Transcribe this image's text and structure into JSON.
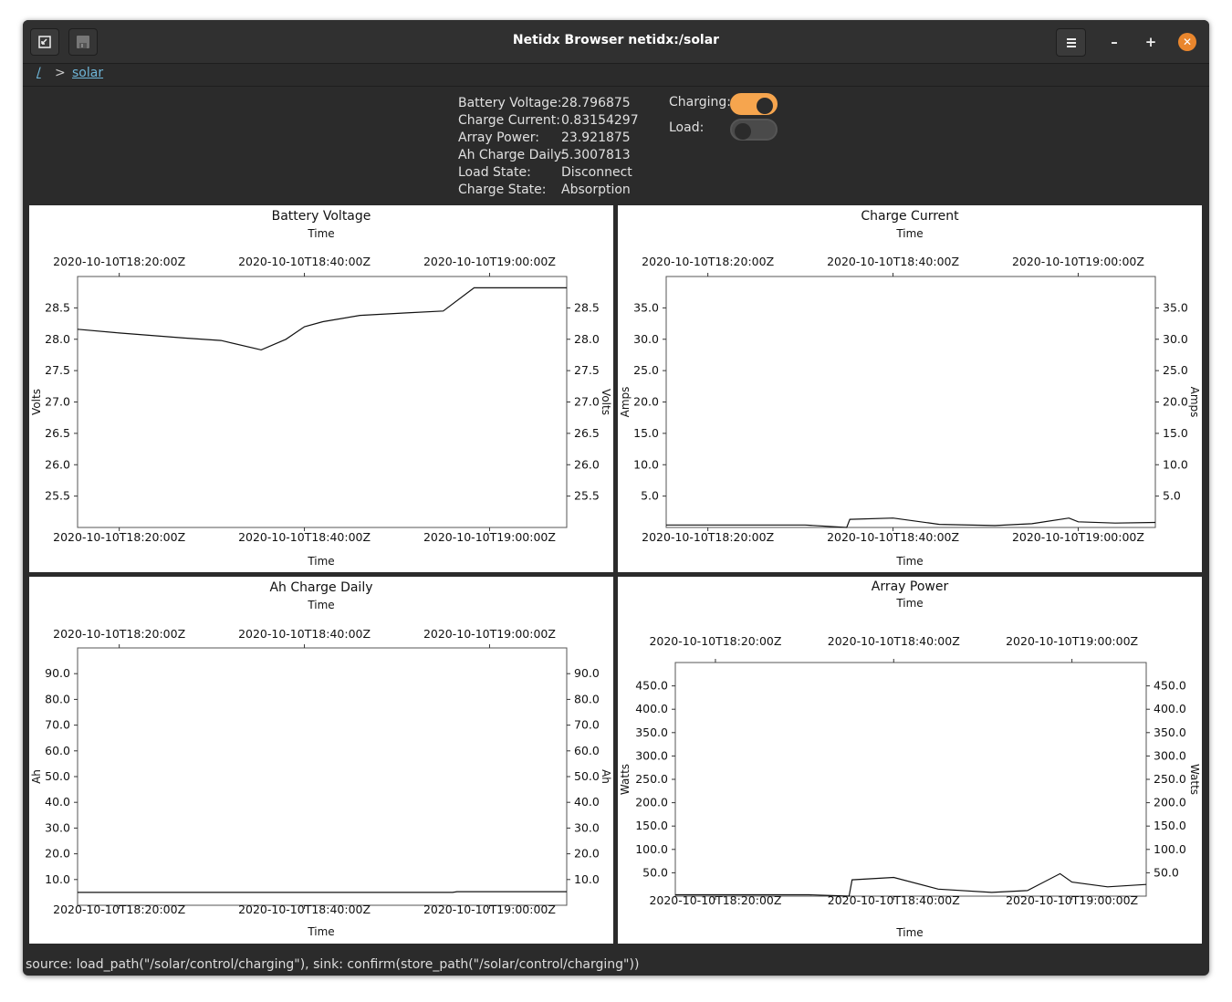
{
  "window": {
    "title": "Netidx Browser netidx:/solar"
  },
  "toolbar": {
    "back_icon": "back-icon",
    "save_icon": "save-icon",
    "menu_icon": "hamburger-menu-icon",
    "minimize": "–",
    "maximize": "+",
    "close": "✕"
  },
  "breadcrumb": {
    "root": "/",
    "separator": ">",
    "current": "solar"
  },
  "info": [
    {
      "label": "Battery Voltage:",
      "value": "28.796875"
    },
    {
      "label": "Charge Current:",
      "value": "0.83154297"
    },
    {
      "label": "Array Power:",
      "value": "23.921875"
    },
    {
      "label": "Ah Charge Daily:",
      "value": "5.3007813"
    },
    {
      "label": "Load State:",
      "value": "Disconnect"
    },
    {
      "label": "Charge State:",
      "value": "Absorption"
    }
  ],
  "toggles": {
    "charging": {
      "label": "Charging:",
      "on": true
    },
    "load": {
      "label": "Load:",
      "on": false
    }
  },
  "accent_color": "#f6a54e",
  "status": "source: load_path(\"/solar/control/charging\"), sink: confirm(store_path(\"/solar/control/charging\"))",
  "chart_data": [
    {
      "type": "line",
      "title": "Battery Voltage",
      "xlabel": "Time",
      "ylabel": "Volts",
      "x_ticks": [
        "2020-10-10T18:20:00Z",
        "2020-10-10T18:40:00Z",
        "2020-10-10T19:00:00Z"
      ],
      "y_ticks": [
        "25.5",
        "26.0",
        "26.5",
        "27.0",
        "27.5",
        "28.0",
        "28.5"
      ],
      "xlim": [
        "2020-10-10T18:15:30Z",
        "2020-10-10T19:08:20Z"
      ],
      "ylim": [
        25.0,
        29.0
      ],
      "series": [
        {
          "x": [
            "2020-10-10T18:15:30Z",
            "2020-10-10T18:20:00Z",
            "2020-10-10T18:27:00Z",
            "2020-10-10T18:31:00Z",
            "2020-10-10T18:35:20Z",
            "2020-10-10T18:38:00Z",
            "2020-10-10T18:40:00Z",
            "2020-10-10T18:42:00Z",
            "2020-10-10T18:46:00Z",
            "2020-10-10T18:51:00Z",
            "2020-10-10T18:55:00Z",
            "2020-10-10T18:58:20Z",
            "2020-10-10T19:08:20Z"
          ],
          "y": [
            28.16,
            28.1,
            28.02,
            27.98,
            27.83,
            28.0,
            28.2,
            28.28,
            28.38,
            28.42,
            28.45,
            28.82,
            28.82
          ]
        }
      ]
    },
    {
      "type": "line",
      "title": "Charge Current",
      "xlabel": "Time",
      "ylabel": "Amps",
      "x_ticks": [
        "2020-10-10T18:20:00Z",
        "2020-10-10T18:40:00Z",
        "2020-10-10T19:00:00Z"
      ],
      "y_ticks": [
        "5.0",
        "10.0",
        "15.0",
        "20.0",
        "25.0",
        "30.0",
        "35.0"
      ],
      "xlim": [
        "2020-10-10T18:15:30Z",
        "2020-10-10T19:08:20Z"
      ],
      "ylim": [
        0,
        40
      ],
      "series": [
        {
          "x": [
            "2020-10-10T18:15:30Z",
            "2020-10-10T18:30:30Z",
            "2020-10-10T18:35:00Z",
            "2020-10-10T18:35:20Z",
            "2020-10-10T18:40:00Z",
            "2020-10-10T18:45:00Z",
            "2020-10-10T18:51:00Z",
            "2020-10-10T18:55:00Z",
            "2020-10-10T18:59:00Z",
            "2020-10-10T19:00:00Z",
            "2020-10-10T19:04:00Z",
            "2020-10-10T19:08:20Z"
          ],
          "y": [
            0.4,
            0.4,
            0.0,
            1.3,
            1.5,
            0.5,
            0.3,
            0.6,
            1.5,
            0.9,
            0.7,
            0.8
          ]
        }
      ]
    },
    {
      "type": "line",
      "title": "Ah Charge Daily",
      "xlabel": "Time",
      "ylabel": "Ah",
      "x_ticks": [
        "2020-10-10T18:20:00Z",
        "2020-10-10T18:40:00Z",
        "2020-10-10T19:00:00Z"
      ],
      "y_ticks": [
        "10.0",
        "20.0",
        "30.0",
        "40.0",
        "50.0",
        "60.0",
        "70.0",
        "80.0",
        "90.0"
      ],
      "xlim": [
        "2020-10-10T18:15:30Z",
        "2020-10-10T19:08:20Z"
      ],
      "ylim": [
        0,
        100
      ],
      "series": [
        {
          "x": [
            "2020-10-10T18:15:30Z",
            "2020-10-10T18:56:00Z",
            "2020-10-10T18:56:30Z",
            "2020-10-10T19:08:20Z"
          ],
          "y": [
            5.0,
            5.0,
            5.3,
            5.3
          ]
        }
      ]
    },
    {
      "type": "line",
      "title": "Array Power",
      "xlabel": "Time",
      "ylabel": "Watts",
      "x_ticks": [
        "2020-10-10T18:20:00Z",
        "2020-10-10T18:40:00Z",
        "2020-10-10T19:00:00Z"
      ],
      "y_ticks": [
        "50.0",
        "100.0",
        "150.0",
        "200.0",
        "250.0",
        "300.0",
        "350.0",
        "400.0",
        "450.0"
      ],
      "xlim": [
        "2020-10-10T18:15:30Z",
        "2020-10-10T19:08:20Z"
      ],
      "ylim": [
        0,
        500
      ],
      "series": [
        {
          "x": [
            "2020-10-10T18:15:30Z",
            "2020-10-10T18:30:30Z",
            "2020-10-10T18:35:00Z",
            "2020-10-10T18:35:20Z",
            "2020-10-10T18:40:00Z",
            "2020-10-10T18:45:00Z",
            "2020-10-10T18:51:00Z",
            "2020-10-10T18:55:00Z",
            "2020-10-10T18:58:40Z",
            "2020-10-10T19:00:00Z",
            "2020-10-10T19:04:00Z",
            "2020-10-10T19:08:20Z"
          ],
          "y": [
            3,
            3,
            0,
            35,
            40,
            15,
            8,
            12,
            48,
            30,
            20,
            25
          ]
        }
      ]
    }
  ]
}
